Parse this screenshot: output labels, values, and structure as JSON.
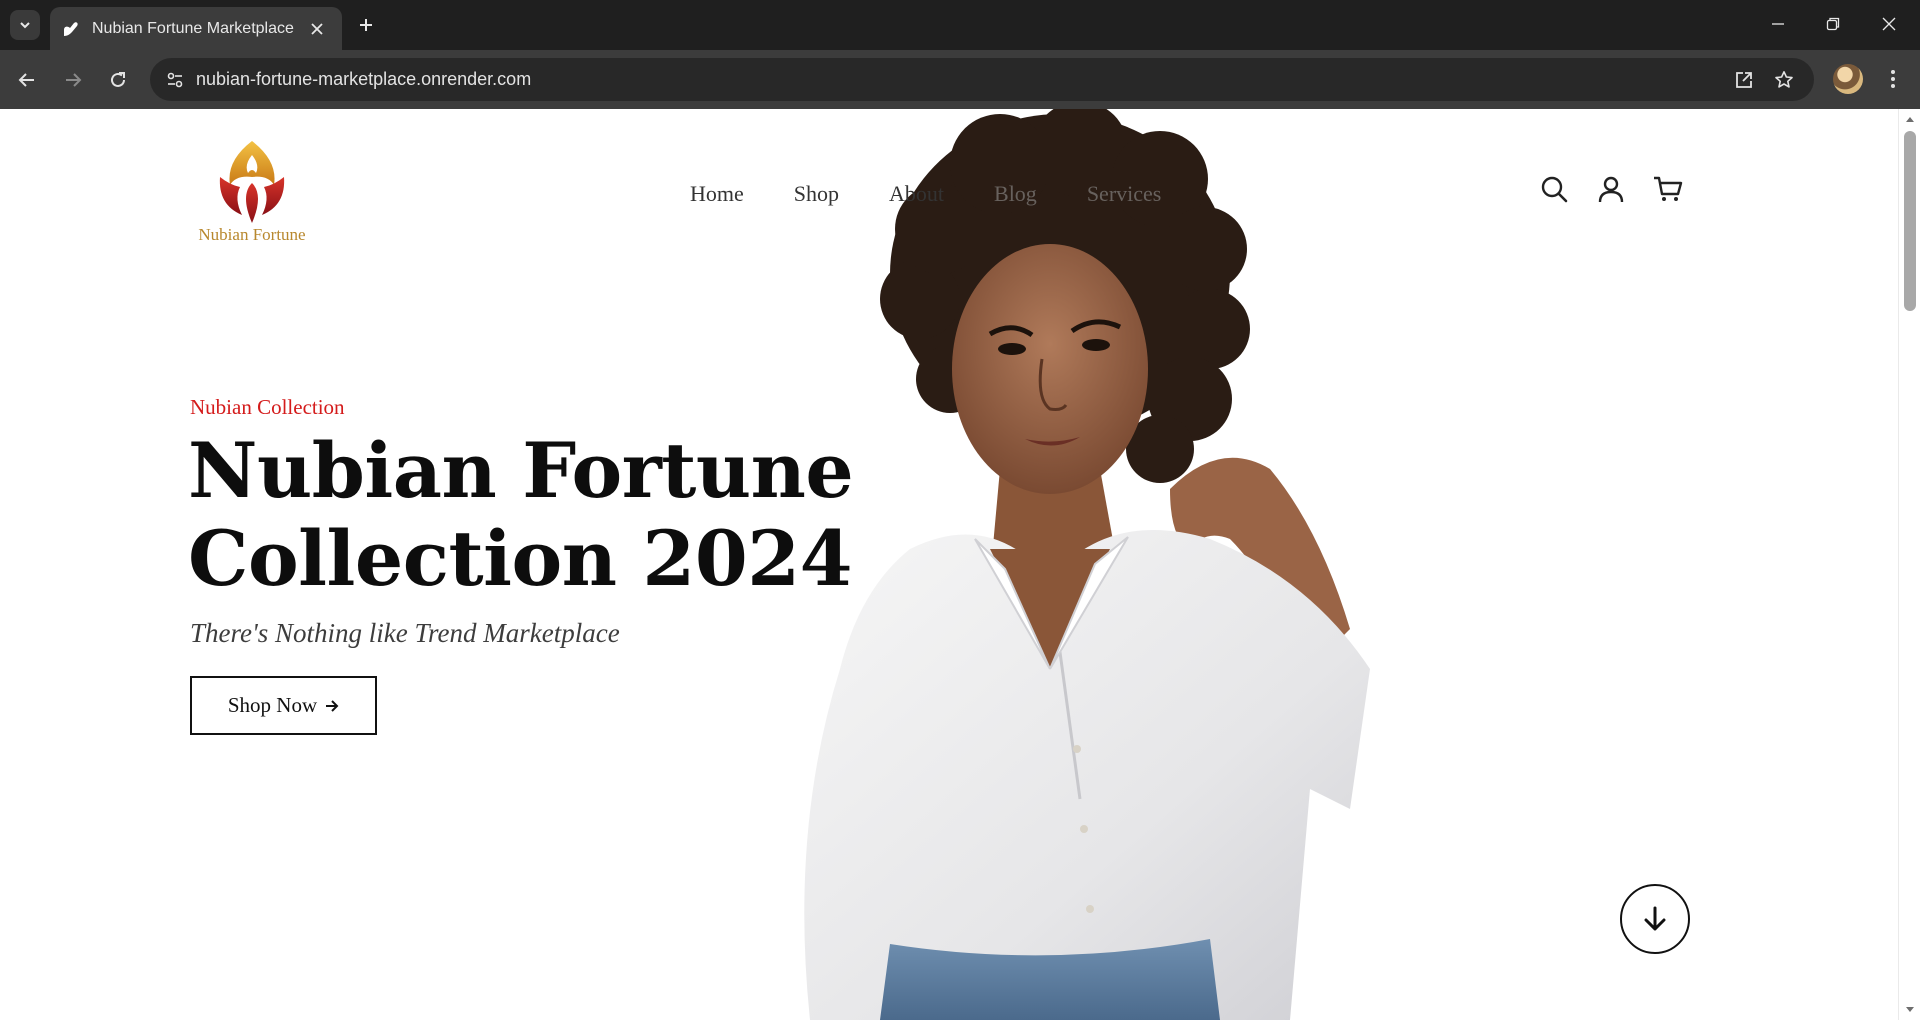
{
  "browser": {
    "tab_title": "Nubian Fortune Marketplace",
    "url": "nubian-fortune-marketplace.onrender.com"
  },
  "site": {
    "logo_text": "Nubian Fortune",
    "nav": [
      {
        "label": "Home"
      },
      {
        "label": "Shop"
      },
      {
        "label": "About"
      },
      {
        "label": "Blog"
      },
      {
        "label": "Services"
      }
    ]
  },
  "hero": {
    "eyebrow": "Nubian Collection",
    "headline_line1": "Nubian Fortune",
    "headline_line2": "Collection 2024",
    "tagline": "There's Nothing like Trend Marketplace",
    "cta_label": "Shop Now",
    "cta_icon": "arrow-right-icon"
  },
  "colors": {
    "accent_red": "#d41b1b",
    "logo_gold": "#b8882e",
    "chrome_dark": "#1f1f1f"
  }
}
